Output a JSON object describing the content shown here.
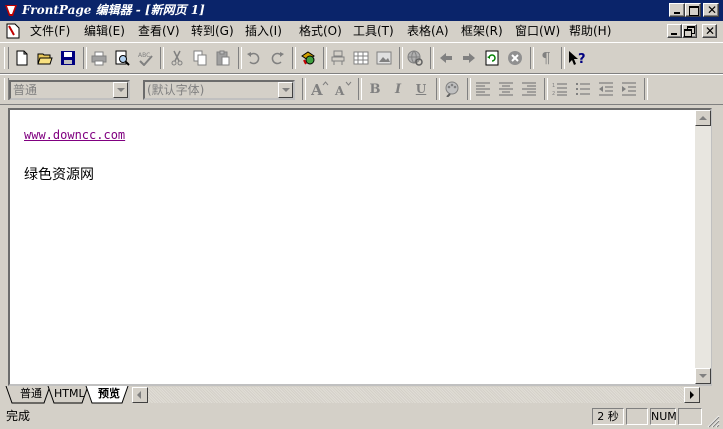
{
  "window": {
    "title": "FrontPage 编辑器 - [新网页 1]"
  },
  "menu": {
    "items": [
      "文件(F)",
      "编辑(E)",
      "查看(V)",
      "转到(G)",
      "插入(I)",
      "格式(O)",
      "工具(T)",
      "表格(A)",
      "框架(R)",
      "窗口(W)",
      "帮助(H)"
    ]
  },
  "format_toolbar": {
    "style_value": "普通",
    "font_value": "(默认字体)"
  },
  "editor": {
    "link_text": "www.downcc.com",
    "body_text": "绿色资源网"
  },
  "view_tabs": [
    "普通",
    "HTML",
    "预览"
  ],
  "statusbar": {
    "status": "完成",
    "time": "2 秒",
    "num": "NUM"
  },
  "colors": {
    "titlebar": "#0a246a",
    "link": "#800080",
    "face": "#d4d0c8"
  }
}
